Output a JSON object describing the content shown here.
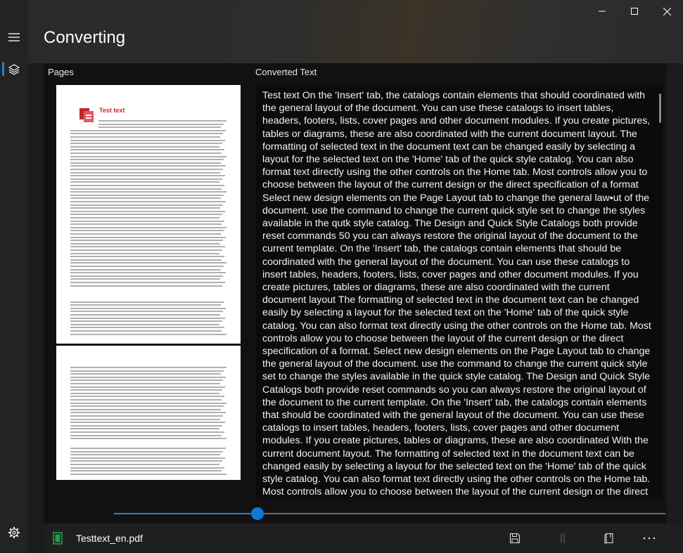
{
  "app": {
    "title": "Converting"
  },
  "window_controls": {
    "minimize": "minimize-icon",
    "maximize": "maximize-icon",
    "close": "close-icon"
  },
  "nav": {
    "menu_icon": "hamburger-icon",
    "items": [
      {
        "icon": "layers-icon",
        "selected": true
      }
    ],
    "settings_icon": "gear-icon"
  },
  "pages_panel": {
    "label": "Pages",
    "page1_heading": "Test text"
  },
  "text_panel": {
    "label": "Converted Text",
    "text": "Test text On the 'Insert' tab, the catalogs contain elements that should coordinated with the general layout of the document. You can use these catalogs to insert tables, headers, footers, lists, cover pages and other document modules. If you create pictures, tables or diagrams, these are also coordinated with the current document layout. The formatting of selected text in the document text can be changed easily by selecting a layout for the selected text on the 'Home' tab of the quick style catalog. You can also format text directly using the other controls on the Home tab. Most controls allow you to choose between the layout of the current design or the direct specification of a format Select new design elements on the Page Layout tab to change the general law•ut of the document. use the command to change the current quick style set to change the styles available in the qutk style catalog. The Design and Quick Style Catalogs both provide reset commands 50 you can always restore the original layout of the document to the current template. On the 'Insert' tab, the catalogs contain elements that should be coordinated with the general layout of the document. You can use these catalogs to insert tables, headers, footers, lists, cover pages and other document modules. If you create pictures, tables or diagrams, these are also coordinated with the current document layout The formatting of selected text in the document text can be changed easily by selecting a layout for the selected text on the 'Home' tab of the quick style catalog. You can also format text directly using the other controls on the Home tab. Most controls allow you to choose between the layout of the current design or the direct specification of a format. Select new design elements on the Page Layout tab to change the general layout of the document. use the command to change the current quick style set to change the styles available in the quick style catalog. The Design and Quick Style Catalogs both provide reset commands so you can always restore the original layout of the document to the current template. On the 'Insert' tab, the catalogs contain elements that should be coordinated with the general layout of the document. You can use these catalogs to insert tables, headers, footers, lists, cover pages and other document modules. If you create pictures, tables or diagrams, these are also coordinated With the current document layout. The formatting of selected text in the document text can be changed easily by selecting a layout for the selected text on the 'Home' tab of the quick style catalog. You can also format text directly using the other controls on the Home tab. Most controls allow you to choose between the layout of the current design or the direct specification of a format. Select new design elements on the Page Layout tab to change the general layout of the document. use"
  },
  "slider": {
    "value_fraction": 0.26
  },
  "bottom_bar": {
    "file_icon": "file-icon",
    "file_name": "Testtext_en.pdf",
    "save_icon": "save-icon",
    "split_icon": "split-view-icon",
    "book_icon": "book-icon",
    "more_icon": "more-icon"
  },
  "colors": {
    "accent": "#0f78d4",
    "heading_red": "#c0282d"
  }
}
